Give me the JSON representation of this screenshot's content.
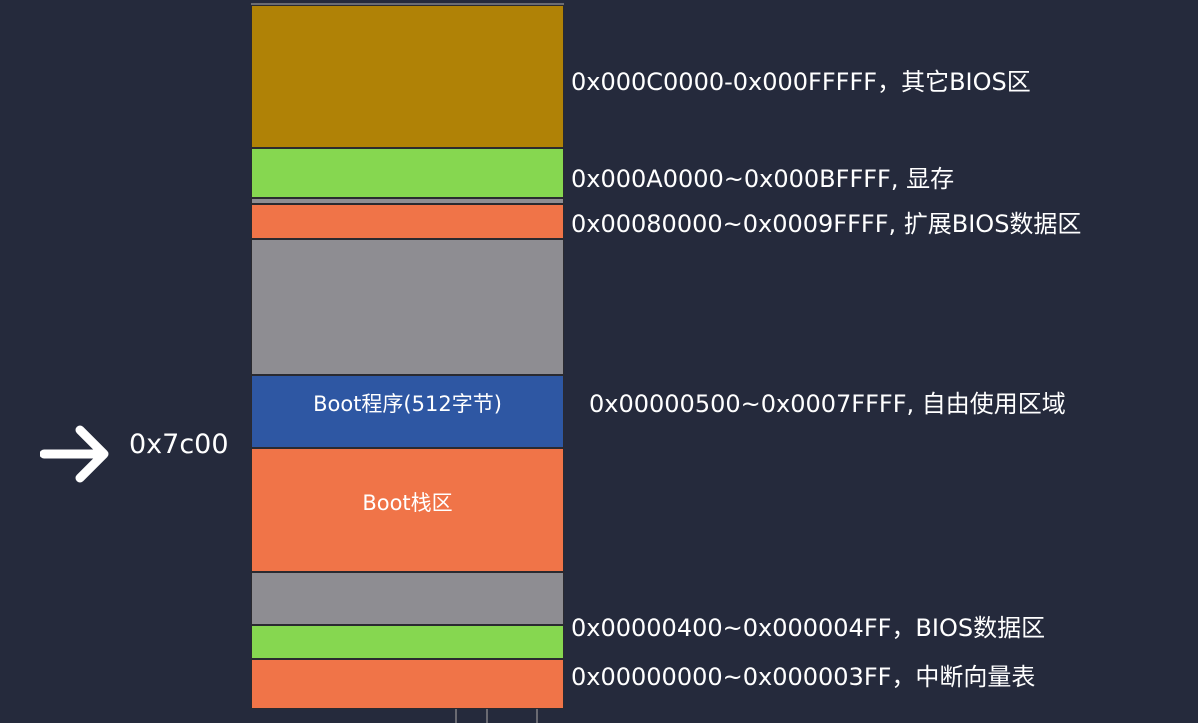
{
  "diagram": {
    "pointer": {
      "icon": "arrow-right-icon",
      "address": "0x7c00"
    },
    "segments": {
      "boot_program": "Boot程序(512字节)",
      "boot_stack": "Boot栈区"
    },
    "labels": {
      "bios_other": "0x000C0000-0x000FFFFF，其它BIOS区",
      "vram": "0x000A0000~0x000BFFFF, 显存",
      "ebda": "0x00080000~0x0009FFFF, 扩展BIOS数据区",
      "free": "0x00000500~0x0007FFFF, 自由使用区域",
      "bda": "0x00000400~0x000004FF，BIOS数据区",
      "ivt": "0x00000000~0x000003FF，中断向量表"
    },
    "colors": {
      "background": "#252a3c",
      "bios_other": "#b08206",
      "green": "#86d750",
      "orange": "#f07448",
      "gray": "#8e8d92",
      "blue": "#2e57a3"
    }
  }
}
